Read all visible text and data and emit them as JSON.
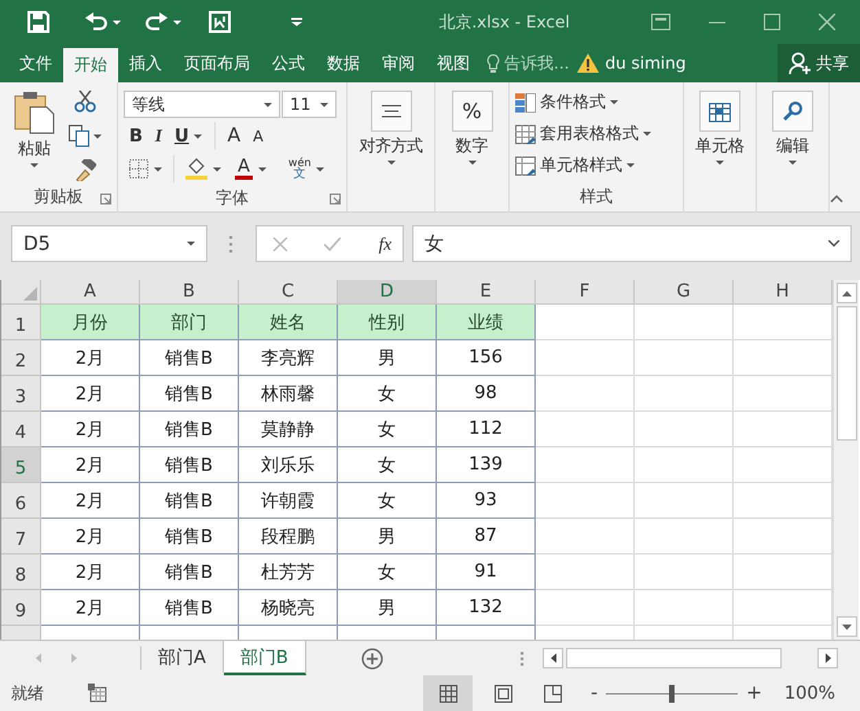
{
  "window": {
    "title": "北京.xlsx - Excel"
  },
  "ribbon_tabs": [
    {
      "label": "文件",
      "selected": false
    },
    {
      "label": "开始",
      "selected": true
    },
    {
      "label": "插入",
      "selected": false
    },
    {
      "label": "页面布局",
      "selected": false
    },
    {
      "label": "公式",
      "selected": false
    },
    {
      "label": "数据",
      "selected": false
    },
    {
      "label": "审阅",
      "selected": false
    },
    {
      "label": "视图",
      "selected": false
    }
  ],
  "tell_me": {
    "placeholder": "告诉我..."
  },
  "user": "du siming",
  "share_button": "共享",
  "clipboard": {
    "paste": "粘贴",
    "label": "剪贴板"
  },
  "font": {
    "name": "等线",
    "size": "11",
    "bold": "B",
    "italic": "I",
    "underline": "U",
    "grow": "A",
    "shrink": "A",
    "font_color": "A",
    "phonetic": "wén",
    "phonetic_char": "文",
    "label": "字体"
  },
  "alignment": {
    "label": "对齐方式"
  },
  "number": {
    "symbol": "%",
    "label": "数字"
  },
  "styles": {
    "items": [
      "条件格式",
      "套用表格格式",
      "单元格样式"
    ],
    "label": "样式"
  },
  "cells": {
    "label": "单元格"
  },
  "editing": {
    "label": "编辑"
  },
  "name_box": "D5",
  "formula": {
    "fx": "fx",
    "value": "女"
  },
  "columns": [
    {
      "label": "A",
      "selected": false
    },
    {
      "label": "B",
      "selected": false
    },
    {
      "label": "C",
      "selected": false
    },
    {
      "label": "D",
      "selected": true
    },
    {
      "label": "E",
      "selected": false
    },
    {
      "label": "F",
      "selected": false
    },
    {
      "label": "G",
      "selected": false
    },
    {
      "label": "H",
      "selected": false
    }
  ],
  "rows": [
    {
      "number": "1",
      "kind": "header",
      "selected": false,
      "cells": [
        "月份",
        "部门",
        "姓名",
        "性别",
        "业绩"
      ]
    },
    {
      "number": "2",
      "kind": "data",
      "selected": false,
      "cells": [
        "2月",
        "销售B",
        "李亮辉",
        "男",
        "156"
      ]
    },
    {
      "number": "3",
      "kind": "data",
      "selected": false,
      "cells": [
        "2月",
        "销售B",
        "林雨馨",
        "女",
        "98"
      ]
    },
    {
      "number": "4",
      "kind": "data",
      "selected": false,
      "cells": [
        "2月",
        "销售B",
        "莫静静",
        "女",
        "112"
      ]
    },
    {
      "number": "5",
      "kind": "data",
      "selected": true,
      "cells": [
        "2月",
        "销售B",
        "刘乐乐",
        "女",
        "139"
      ]
    },
    {
      "number": "6",
      "kind": "data",
      "selected": false,
      "cells": [
        "2月",
        "销售B",
        "许朝霞",
        "女",
        "93"
      ]
    },
    {
      "number": "7",
      "kind": "data",
      "selected": false,
      "cells": [
        "2月",
        "销售B",
        "段程鹏",
        "男",
        "87"
      ]
    },
    {
      "number": "8",
      "kind": "data",
      "selected": false,
      "cells": [
        "2月",
        "销售B",
        "杜芳芳",
        "女",
        "91"
      ]
    },
    {
      "number": "9",
      "kind": "data",
      "selected": false,
      "cells": [
        "2月",
        "销售B",
        "杨晓亮",
        "男",
        "132"
      ]
    }
  ],
  "sheets": [
    {
      "label": "部门A",
      "selected": false
    },
    {
      "label": "部门B",
      "selected": true
    }
  ],
  "status": "就绪",
  "zoom": {
    "minus": "-",
    "plus": "+",
    "level": 0.5,
    "reading": "100%"
  }
}
